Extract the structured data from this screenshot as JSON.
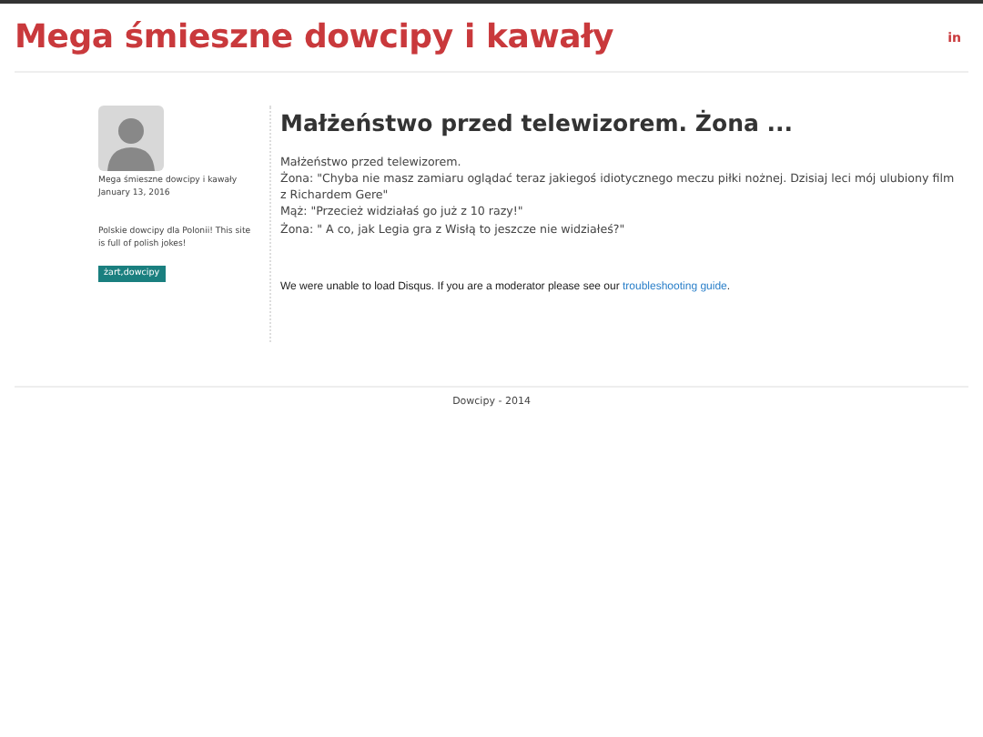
{
  "site_title": "Mega śmieszne dowcipy i kawały",
  "header_link": "in",
  "sidebar": {
    "author": "Mega śmieszne dowcipy i kawały",
    "date": "January 13, 2016",
    "description": "Polskie dowcipy dla Polonii! This site is full of polish jokes!",
    "tag": "żart,dowcipy"
  },
  "post": {
    "title": "Małżeństwo przed telewizorem. Żona ...",
    "paragraphs": [
      "Małżeństwo przed telewizorem.",
      "Żona: \"Chyba nie masz zamiaru oglądać teraz jakiegoś idiotycznego meczu piłki nożnej. Dzisiaj leci mój ulubiony film z Richardem Gere\"",
      "Mąż: \"Przecież widziałaś go już z 10 razy!\"",
      "Żona: \" A co, jak Legia gra z Wisłą to jeszcze nie widziałeś?\""
    ]
  },
  "disqus": {
    "message": "We were unable to load Disqus. If you are a moderator please see our",
    "link": "troubleshooting guide",
    "end": "."
  },
  "footer": "Dowcipy - 2014"
}
